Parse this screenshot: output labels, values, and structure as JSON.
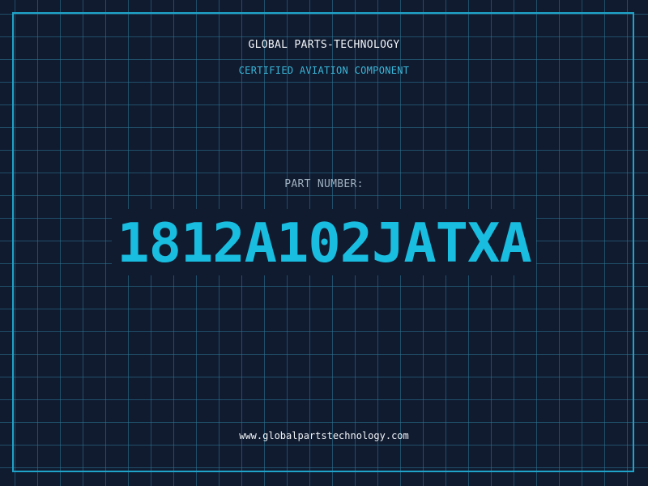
{
  "header": {
    "company": "GLOBAL PARTS-TECHNOLOGY",
    "certification": "CERTIFIED AVIATION COMPONENT"
  },
  "part": {
    "label": "PART NUMBER:",
    "number": "1812A102JATXA"
  },
  "footer": {
    "website": "www.globalpartstechnology.com"
  },
  "colors": {
    "background": "#101b30",
    "grid": "#2e7896",
    "border": "#1fa3c9",
    "accent": "#18bde0"
  }
}
